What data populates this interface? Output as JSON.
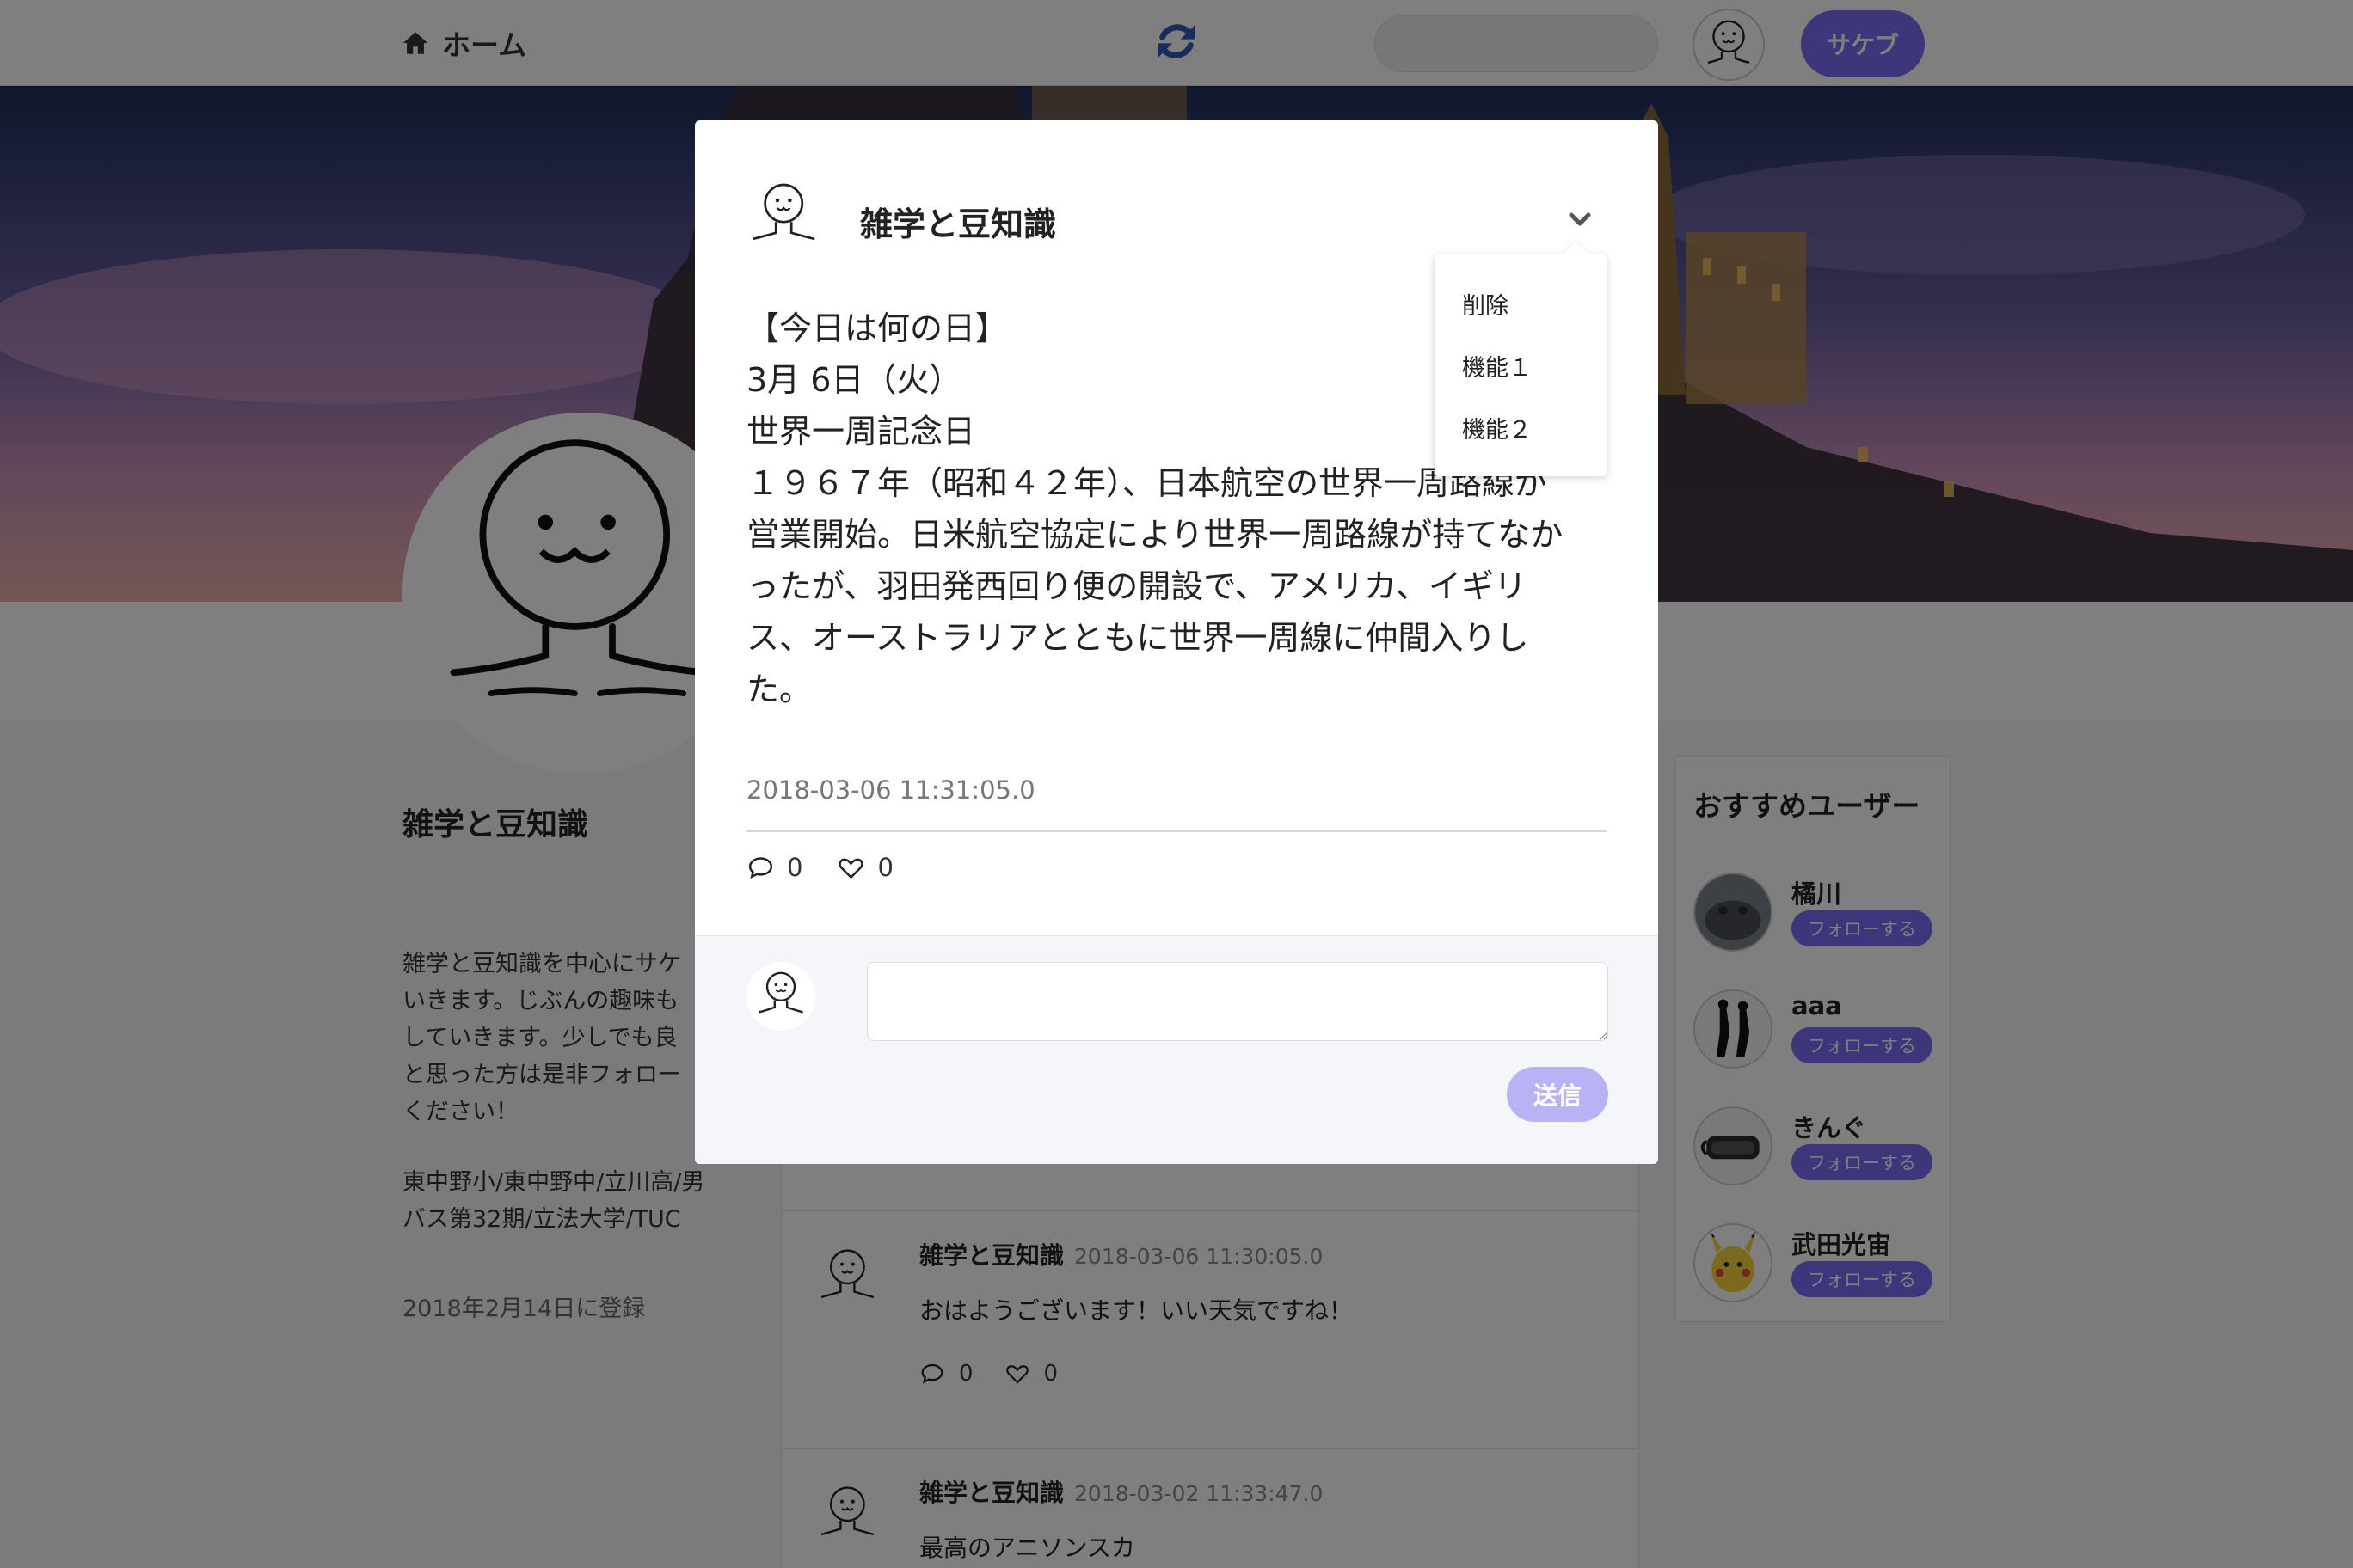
{
  "navbar": {
    "home_label": "ホーム",
    "post_button": "サケブ",
    "search_placeholder": ""
  },
  "profile": {
    "name": "雑学と豆知識",
    "bio": "雑学と豆知識を中心にサケ\nいきます。じぶんの趣味も\nしていきます。少しでも良\nと思った方は是非フォロー\nください！",
    "school": "東中野小/東中野中/立川高/男\nバス第32期/立法大学/TUC",
    "joined": "2018年2月14日に登録"
  },
  "timeline": {
    "posts": [
      {
        "author": "雑学と豆知識",
        "date": "2018-03-06 11:30:05.0",
        "text": "おはようございます！いい天気ですね！",
        "comments": "0",
        "likes": "0"
      },
      {
        "author": "雑学と豆知識",
        "date": "2018-03-02 11:33:47.0",
        "text": "最高のアニソンスカ",
        "comments": "",
        "likes": ""
      }
    ]
  },
  "recommended": {
    "title": "おすすめユーザー",
    "follow_label": "フォローする",
    "users": [
      {
        "name": "橘川"
      },
      {
        "name": "aaa"
      },
      {
        "name": "きんぐ"
      },
      {
        "name": "武田光宙"
      }
    ]
  },
  "modal": {
    "author": "雑学と豆知識",
    "text_lines": [
      "【今日は何の日】",
      "3月 6日（火）",
      "世界一周記念日",
      "１９６７年（昭和４２年）、日本航空の世界一周路線が",
      "営業開始。日米航空協定により世界一周路線が持てなか",
      "ったが、羽田発西回り便の開設で、アメリカ、イギリ",
      "ス、オーストラリアとともに世界一周線に仲間入りし",
      "た。"
    ],
    "date": "2018-03-06 11:31:05.0",
    "comments": "0",
    "likes": "0",
    "reply_placeholder": "",
    "send_label": "送信"
  },
  "dropdown": {
    "items": [
      "削除",
      "機能１",
      "機能２"
    ]
  },
  "colors": {
    "accent": "#7b6cf6",
    "accent_light": "#b9b3f5",
    "overlay": "rgba(0,0,0,0.5)"
  },
  "icons": [
    "home-icon",
    "refresh-icon",
    "chevron-down-icon",
    "comment-icon",
    "heart-icon"
  ]
}
